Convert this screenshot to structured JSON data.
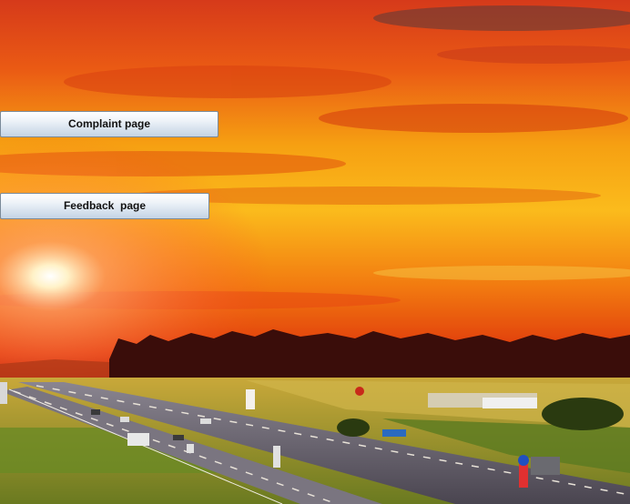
{
  "buttons": {
    "complaint_label": "Complaint page",
    "feedback_label": "Feedback  page"
  },
  "background": {
    "sky_top": "#e2421a",
    "sky_mid": "#f59a10",
    "sky_glow": "#ffd23a",
    "treeline": "#3a0d0a",
    "field": "#9c8a2a",
    "road": "#5a5560"
  }
}
